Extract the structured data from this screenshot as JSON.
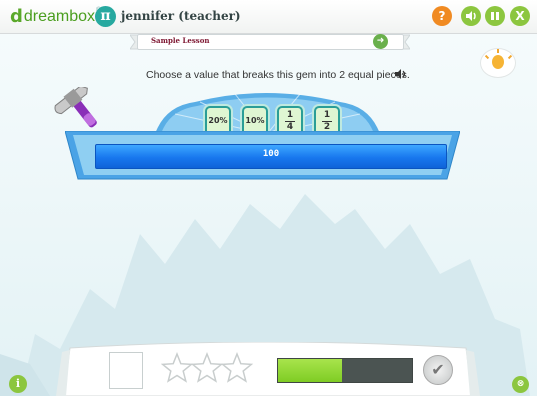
{
  "brand": {
    "letter": "d",
    "name": "dreambox",
    "tm": "®"
  },
  "user": {
    "avatar_glyph": "π",
    "name": "jennifer (teacher)"
  },
  "toolbar": {
    "help_glyph": "?",
    "sound_glyph": "◀)",
    "pause_glyph": "II",
    "close_glyph": "X",
    "help_icon": "question-circle-icon",
    "close_icon": "x-circle-icon"
  },
  "lesson": {
    "title": "Sample Lesson",
    "next_glyph": "➜"
  },
  "prompt": {
    "text": "Choose a value that breaks this gem into 2 equal pieces.",
    "audio_glyph": "◀)"
  },
  "choices": [
    {
      "type": "text",
      "label": "20%"
    },
    {
      "type": "text",
      "label": "10%"
    },
    {
      "type": "fraction",
      "numerator": "1",
      "denominator": "4"
    },
    {
      "type": "fraction",
      "numerator": "1",
      "denominator": "2"
    }
  ],
  "gem": {
    "value": "100"
  },
  "bottom": {
    "stars_total": 3,
    "stars_earned": 0,
    "progress_fraction": 0.48,
    "check_glyph": "✔"
  },
  "info_glyph": "i",
  "corner_glyph": "⊗",
  "colors": {
    "accent_green": "#8cc63f",
    "help_orange": "#f08a22",
    "gem_blue": "#1877ee",
    "progress_green": "#8fd335"
  }
}
